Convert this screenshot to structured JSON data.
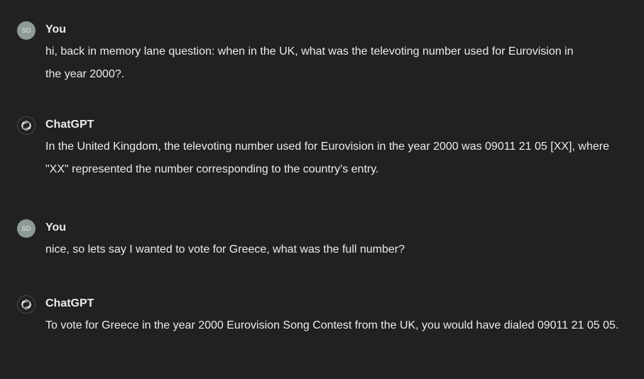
{
  "messages": [
    {
      "author": "You",
      "avatar_initials": "SD",
      "text": "hi, back in memory lane question: when in the UK, what was the  televoting number used for Eurovision in the year 2000?."
    },
    {
      "author": "ChatGPT",
      "avatar_icon": "openai-logo-icon",
      "text": "In the United Kingdom, the televoting number used for Eurovision in the year 2000 was 09011 21 05 [XX], where \"XX\" represented the number corresponding to the country's entry."
    },
    {
      "author": "You",
      "avatar_initials": "SD",
      "text": "nice, so lets say I wanted to vote for Greece, what was the full number?"
    },
    {
      "author": "ChatGPT",
      "avatar_icon": "openai-logo-icon",
      "text": "To vote for Greece in the year 2000 Eurovision Song Contest from the UK, you would have dialed 09011 21 05 05."
    }
  ],
  "colors": {
    "background": "#212121",
    "text": "#ececec",
    "user_avatar": "#8e9a94"
  }
}
